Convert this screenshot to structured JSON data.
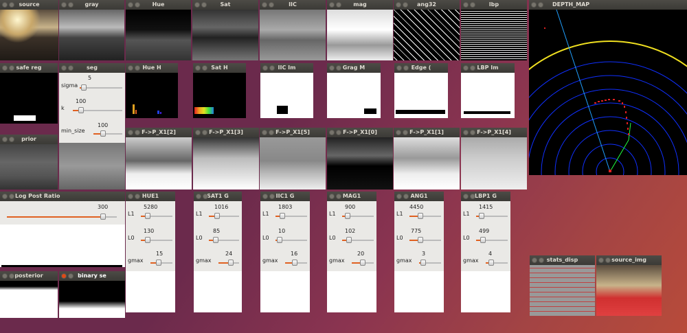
{
  "windows": {
    "source": "source",
    "gray": "gray",
    "hue": "Hue",
    "sat": "Sat",
    "iic": "IIC",
    "mag": "mag",
    "ang32": "ang32",
    "lbp": "lbp",
    "depth_map": "DEPTH_MAP",
    "safe_reg": "safe reg",
    "seg": "seg",
    "hue_h": "Hue H",
    "sat_h": "Sat H",
    "iic_im": "IIC Im",
    "grag": "Grag M",
    "edge": "Edge (",
    "lbp_im": "LBP Im",
    "prior": "prior",
    "fpx1_2": "F->P_X1[2]",
    "fpx1_3": "F->P_X1[3]",
    "fpx1_5": "F->P_X1[5]",
    "fpx1_0": "F->P_X1[0]",
    "fpx1_1": "F->P_X1[1]",
    "fpx1_4": "F->P_X1[4]",
    "log_post": "Log Post Ratio",
    "hue1": "HUE1",
    "sat1": "SAT1 G",
    "iic1": "IIC1 G",
    "mag1": "MAG1",
    "ang1": "ANG1",
    "lbp1": "LBP1 G",
    "posterior": "posterior",
    "binary": "binary se",
    "stats_disp": "stats_disp",
    "source_img": "source_img"
  },
  "seg": {
    "sigma_label": "sigma",
    "sigma_val": "5",
    "k_label": "k",
    "k_val": "100",
    "minsize_label": "min_size",
    "minsize_val": "100"
  },
  "log_post": {
    "val": "300"
  },
  "trackbars": {
    "hue1": {
      "l1": "5280",
      "l0": "130",
      "gmax": "15"
    },
    "sat1": {
      "l1": "1016",
      "l0": "85",
      "gmax": "24"
    },
    "iic1": {
      "l1": "1803",
      "l0": "10",
      "gmax": "16"
    },
    "mag1": {
      "l1": "900",
      "l0": "102",
      "gmax": "20"
    },
    "ang1": {
      "l1": "4450",
      "l0": "775",
      "gmax": "3"
    },
    "lbp1": {
      "l1": "1415",
      "l0": "499",
      "gmax": "4"
    }
  },
  "tb_labels": {
    "l1": "L1",
    "l0": "L0",
    "gmax": "gmax"
  },
  "colors": {
    "accent": "#e06020",
    "close": "#df4a16",
    "depth_arc": "#f0e020"
  }
}
